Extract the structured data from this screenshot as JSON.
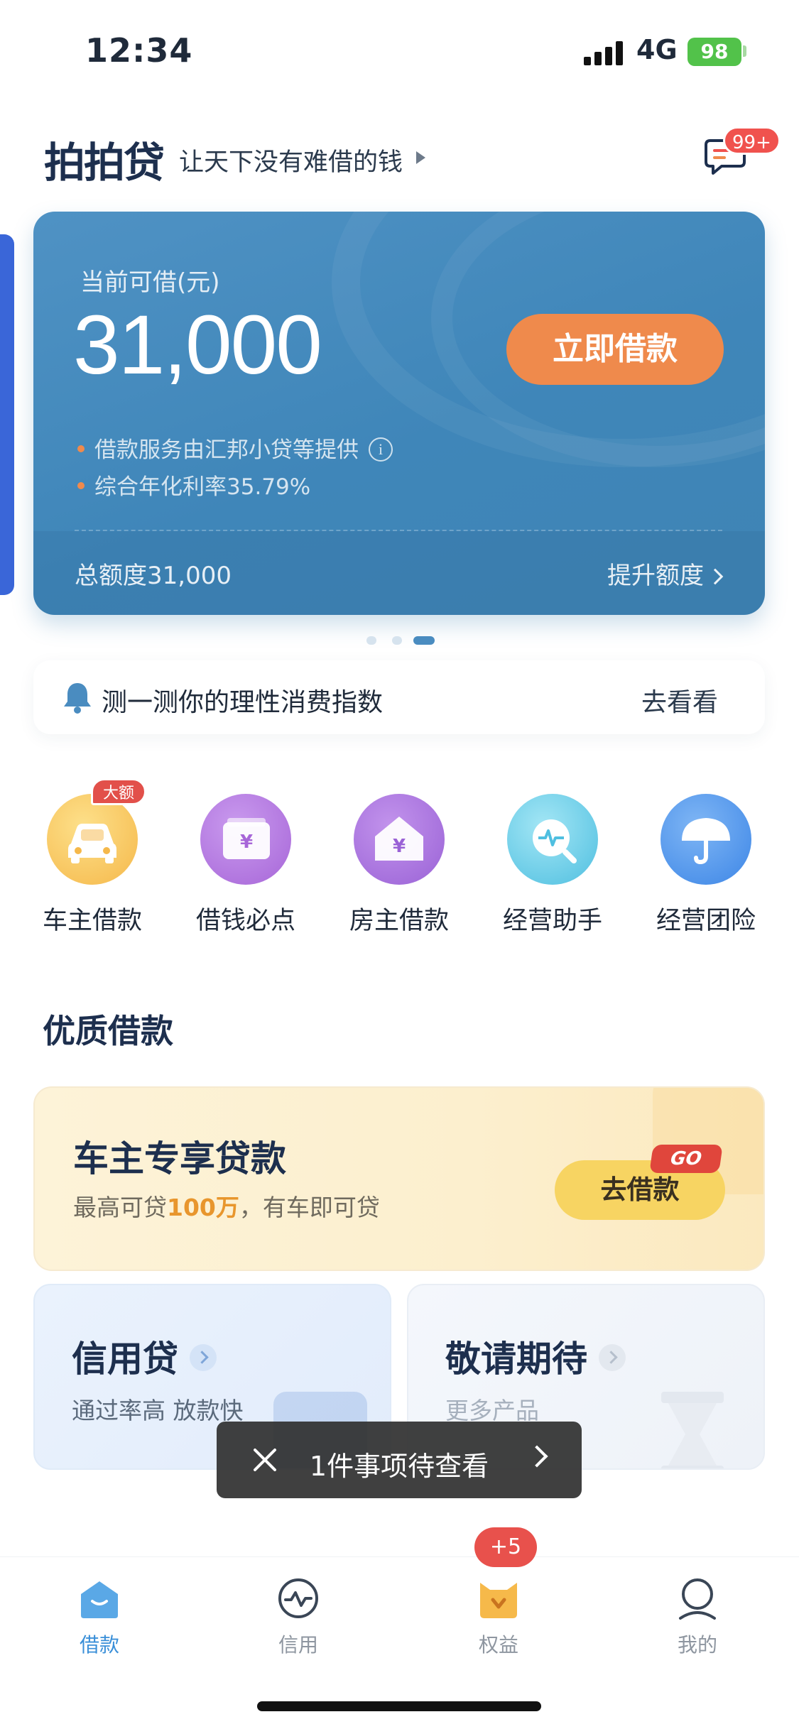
{
  "status_bar": {
    "time": "12:34",
    "network": "4G",
    "battery": "98"
  },
  "header": {
    "logo": "拍拍贷",
    "slogan": "让天下没有难借的钱",
    "message_badge": "99+"
  },
  "loan_card": {
    "label": "当前可借(元)",
    "amount": "31,000",
    "borrow_button": "立即借款",
    "note1": "借款服务由汇邦小贷等提供",
    "note2": "综合年化利率35.79%",
    "total_quota": "总额度31,000",
    "raise_quota": "提升额度"
  },
  "carousel": {
    "count": 3,
    "active_index": 2
  },
  "notice": {
    "text": "测一测你的理性消费指数",
    "link": "去看看"
  },
  "entries": [
    {
      "label": "车主借款",
      "badge": "大额",
      "icon": "car-icon",
      "color": "#f5b84a"
    },
    {
      "label": "借钱必点",
      "icon": "wallet-yen-icon",
      "color": "#a766d8"
    },
    {
      "label": "房主借款",
      "icon": "house-yen-icon",
      "color": "#9a62d6"
    },
    {
      "label": "经营助手",
      "icon": "pulse-search-icon",
      "color": "#4fbfe0"
    },
    {
      "label": "经营团险",
      "icon": "umbrella-icon",
      "color": "#3d86e6"
    }
  ],
  "section_title": "优质借款",
  "car_banner": {
    "title": "车主专享贷款",
    "sub_prefix": "最高可贷",
    "sub_highlight": "100万",
    "sub_suffix": "，有车即可贷",
    "button": "去借款",
    "badge": "GO"
  },
  "products": [
    {
      "title": "信用贷",
      "sub": "通过率高 放款快"
    },
    {
      "title": "敬请期待",
      "sub": "更多产品"
    }
  ],
  "toast": {
    "text": "1件事项待查看"
  },
  "tabbar": {
    "items": [
      {
        "label": "借款",
        "icon": "home-loan-icon"
      },
      {
        "label": "信用",
        "icon": "credit-pulse-icon"
      },
      {
        "label": "权益",
        "icon": "rewards-cat-icon"
      },
      {
        "label": "我的",
        "icon": "profile-icon"
      }
    ],
    "badge": "+5",
    "active_index": 0
  },
  "colors": {
    "primary": "#3a8fd8",
    "accent": "#ef8a4c",
    "card": "#4a8cc0",
    "badge": "#e8514c"
  }
}
